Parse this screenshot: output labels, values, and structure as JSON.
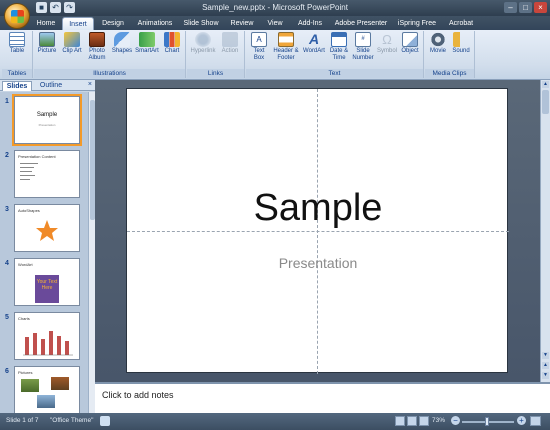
{
  "window": {
    "title": "Sample_new.pptx - Microsoft PowerPoint"
  },
  "tabs": [
    "Home",
    "Insert",
    "Design",
    "Animations",
    "Slide Show",
    "Review",
    "View",
    "Add-Ins",
    "Adobe Presenter",
    "iSpring Free",
    "Acrobat"
  ],
  "active_tab": "Insert",
  "ribbon": {
    "groups": {
      "tables": "Tables",
      "illustrations": "Illustrations",
      "links": "Links",
      "text": "Text",
      "media": "Media Clips"
    },
    "buttons": {
      "table": "Table",
      "picture": "Picture",
      "clipart": "Clip Art",
      "photo_album": "Photo Album",
      "shapes": "Shapes",
      "smartart": "SmartArt",
      "chart": "Chart",
      "hyperlink": "Hyperlink",
      "action": "Action",
      "text_box": "Text Box",
      "header_footer": "Header & Footer",
      "wordart": "WordArt",
      "date_time": "Date & Time",
      "slide_number": "Slide Number",
      "symbol": "Symbol",
      "object": "Object",
      "movie": "Movie",
      "sound": "Sound"
    }
  },
  "panel": {
    "tabs": [
      "Slides",
      "Outline"
    ],
    "close": "×"
  },
  "thumbnails": [
    {
      "num": "1",
      "title": "Sample",
      "sub": "Presentation"
    },
    {
      "num": "2",
      "title": "Presentation Content"
    },
    {
      "num": "3",
      "title": "AutoShapes"
    },
    {
      "num": "4",
      "title": "WordArt",
      "text": "Your Text Here"
    },
    {
      "num": "5",
      "title": "Charts"
    },
    {
      "num": "6",
      "title": "Pictures"
    }
  ],
  "slide": {
    "title": "Sample",
    "subtitle": "Presentation"
  },
  "notes": {
    "placeholder": "Click to add notes"
  },
  "status": {
    "slide_info": "Slide 1 of 7",
    "theme": "\"Office Theme\"",
    "zoom": "73%"
  },
  "colors": {
    "accent": "#f39a2a",
    "ribbon": "#dbe6f3",
    "workspace": "#4e5c6c"
  }
}
